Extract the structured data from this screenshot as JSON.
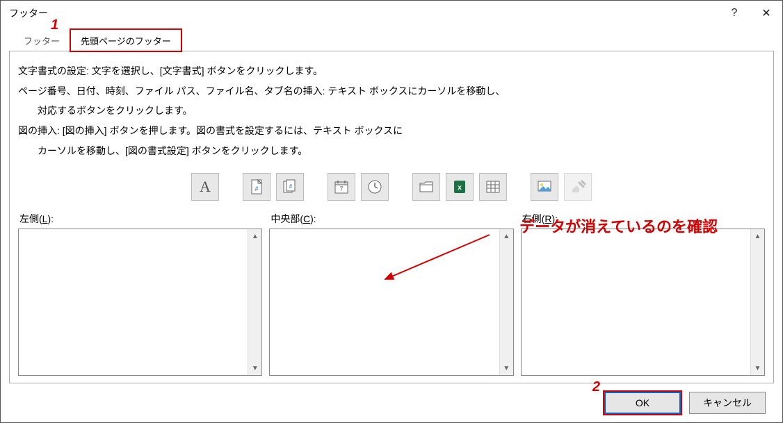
{
  "titlebar": {
    "title": "フッター",
    "help": "?",
    "close": "✕"
  },
  "tabs": {
    "footer": "フッター",
    "firstpage": "先頭ページのフッター"
  },
  "instructions": {
    "l1": "文字書式の設定: 文字を選択し、[文字書式] ボタンをクリックします。",
    "l2": "ページ番号、日付、時刻、ファイル パス、ファイル名、タブ名の挿入: テキスト ボックスにカーソルを移動し、",
    "l3": "対応するボタンをクリックします。",
    "l4": "図の挿入: [図の挿入] ボタンを押します。図の書式を設定するには、テキスト ボックスに",
    "l5": "カーソルを移動し、[図の書式設定] ボタンをクリックします。"
  },
  "icons": {
    "text_format": "A",
    "page_number": "page-number",
    "total_pages": "total-pages",
    "date": "date",
    "time": "time",
    "file_path": "file-path",
    "file_name": "file-name",
    "sheet_name": "sheet-name",
    "insert_picture": "insert-picture",
    "format_picture": "format-picture"
  },
  "sections": {
    "left_label_pre": "左側(",
    "left_label_key": "L",
    "left_label_post": "):",
    "center_label_pre": "中央部(",
    "center_label_key": "C",
    "center_label_post": "):",
    "right_label_pre": "右側(",
    "right_label_key": "R",
    "right_label_post": "):",
    "left_value": "",
    "center_value": "",
    "right_value": ""
  },
  "buttons": {
    "ok": "OK",
    "cancel": "キャンセル"
  },
  "annotations": {
    "n1": "1",
    "n2": "2",
    "confirm_text": "データが消えているのを確認"
  }
}
